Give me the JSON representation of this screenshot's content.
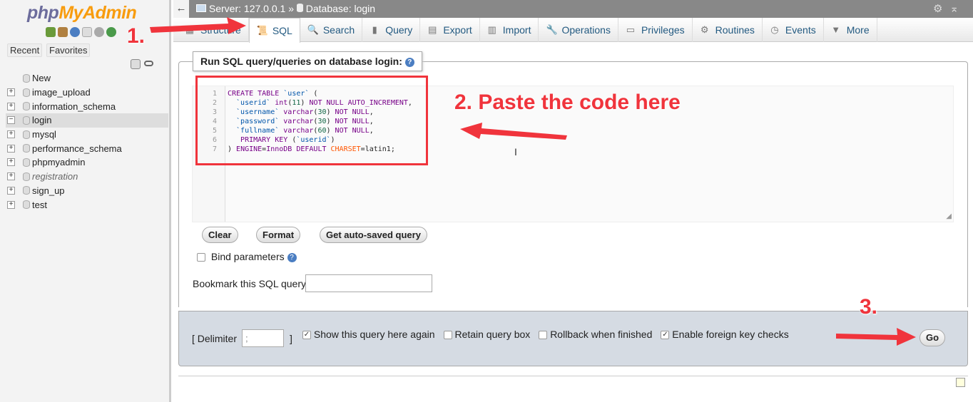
{
  "sidebar": {
    "logo_a": "php",
    "logo_b": "MyAdmin",
    "recent": "Recent",
    "favorites": "Favorites",
    "items": [
      {
        "label": "New"
      },
      {
        "label": "image_upload"
      },
      {
        "label": "information_schema"
      },
      {
        "label": "login",
        "selected": true
      },
      {
        "label": "mysql"
      },
      {
        "label": "performance_schema"
      },
      {
        "label": "phpmyadmin"
      },
      {
        "label": "registration",
        "italic": true
      },
      {
        "label": "sign_up"
      },
      {
        "label": "test"
      }
    ]
  },
  "topbar": {
    "server": "Server: 127.0.0.1",
    "sep": "»",
    "database": "Database: login"
  },
  "tabs": [
    {
      "label": "Structure",
      "icon": "structure-icon"
    },
    {
      "label": "SQL",
      "icon": "sql-icon",
      "active": true
    },
    {
      "label": "Search",
      "icon": "search-icon"
    },
    {
      "label": "Query",
      "icon": "query-icon"
    },
    {
      "label": "Export",
      "icon": "export-icon"
    },
    {
      "label": "Import",
      "icon": "import-icon"
    },
    {
      "label": "Operations",
      "icon": "wrench-icon"
    },
    {
      "label": "Privileges",
      "icon": "privileges-icon"
    },
    {
      "label": "Routines",
      "icon": "routines-icon"
    },
    {
      "label": "Events",
      "icon": "clock-icon"
    },
    {
      "label": "More",
      "icon": "triangle-down-icon"
    }
  ],
  "query": {
    "legend": "Run SQL query/queries on database login:",
    "code": [
      [
        [
          "CREATE TABLE ",
          "kw"
        ],
        [
          "`user`",
          "id"
        ],
        [
          " (",
          "tx"
        ]
      ],
      [
        [
          "  `userid`",
          "id"
        ],
        [
          " int",
          "kw"
        ],
        [
          "(",
          "tx"
        ],
        [
          "11",
          "num"
        ],
        [
          ") ",
          "tx"
        ],
        [
          "NOT NULL AUTO_INCREMENT",
          "kw"
        ],
        [
          ",",
          "tx"
        ]
      ],
      [
        [
          "  `username`",
          "id"
        ],
        [
          " varchar",
          "kw"
        ],
        [
          "(",
          "tx"
        ],
        [
          "30",
          "num"
        ],
        [
          ") ",
          "tx"
        ],
        [
          "NOT NULL",
          "kw"
        ],
        [
          ",",
          "tx"
        ]
      ],
      [
        [
          "  `password`",
          "id"
        ],
        [
          " varchar",
          "kw"
        ],
        [
          "(",
          "tx"
        ],
        [
          "30",
          "num"
        ],
        [
          ") ",
          "tx"
        ],
        [
          "NOT NULL",
          "kw"
        ],
        [
          ",",
          "tx"
        ]
      ],
      [
        [
          "  `fullname`",
          "id"
        ],
        [
          " varchar",
          "kw"
        ],
        [
          "(",
          "tx"
        ],
        [
          "60",
          "num"
        ],
        [
          ") ",
          "tx"
        ],
        [
          "NOT NULL",
          "kw"
        ],
        [
          ",",
          "tx"
        ]
      ],
      [
        [
          "   PRIMARY KEY ",
          "kw"
        ],
        [
          "(",
          "tx"
        ],
        [
          "`userid`",
          "id"
        ],
        [
          ")",
          "tx"
        ]
      ],
      [
        [
          ") ",
          "tx"
        ],
        [
          "ENGINE",
          "kw"
        ],
        [
          "=",
          "tx"
        ],
        [
          "InnoDB DEFAULT ",
          "kw"
        ],
        [
          "CHARSET",
          "bi"
        ],
        [
          "=latin1;",
          "tx"
        ]
      ]
    ],
    "clear": "Clear",
    "format": "Format",
    "autosaved": "Get auto-saved query",
    "bind_params": "Bind parameters",
    "bookmark_label": "Bookmark this SQL query:",
    "bookmark_value": ""
  },
  "options": {
    "delimiter_label": "[ Delimiter",
    "delimiter_value": ";",
    "close_bracket": "]",
    "show_query": "Show this query here again",
    "retain": "Retain query box",
    "rollback": "Rollback when finished",
    "fk_checks": "Enable foreign key checks",
    "go": "Go"
  },
  "annotations": {
    "step1": "1.",
    "step2": "2. Paste the code here",
    "step3": "3.",
    "color": "#f0343c"
  }
}
